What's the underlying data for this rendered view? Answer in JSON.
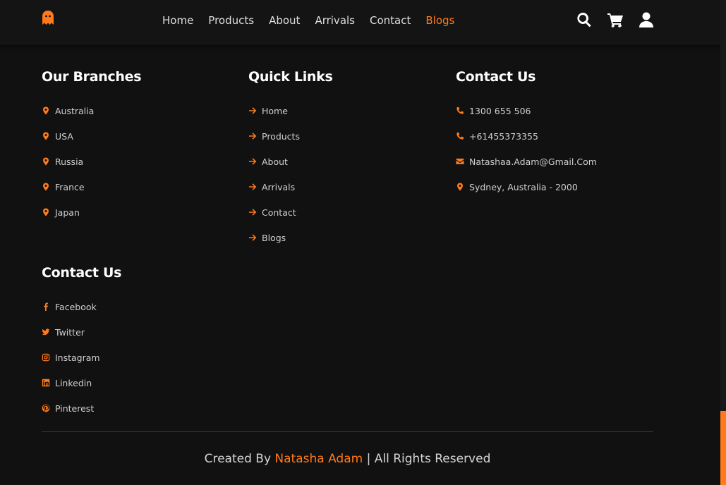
{
  "colors": {
    "accent": "#ff7a1a",
    "background": "#111111",
    "text": "#d6d6d6"
  },
  "nav": {
    "logo_icon": "ghost-logo-icon",
    "links": [
      {
        "label": "Home"
      },
      {
        "label": "Products"
      },
      {
        "label": "About"
      },
      {
        "label": "Arrivals"
      },
      {
        "label": "Contact"
      },
      {
        "label": "Blogs",
        "active": true
      }
    ],
    "icons": [
      "search-icon",
      "shopping-cart-icon",
      "user-icon"
    ]
  },
  "branches": {
    "title": "Our Branches",
    "items": [
      {
        "label": "Australia",
        "icon": "map-marker-icon"
      },
      {
        "label": "USA",
        "icon": "map-marker-icon"
      },
      {
        "label": "Russia",
        "icon": "map-marker-icon"
      },
      {
        "label": "France",
        "icon": "map-marker-icon"
      },
      {
        "label": "Japan",
        "icon": "map-marker-icon"
      }
    ]
  },
  "quick_links": {
    "title": "Quick Links",
    "items": [
      {
        "label": "Home",
        "icon": "arrow-right-icon"
      },
      {
        "label": "Products",
        "icon": "arrow-right-icon"
      },
      {
        "label": "About",
        "icon": "arrow-right-icon"
      },
      {
        "label": "Arrivals",
        "icon": "arrow-right-icon"
      },
      {
        "label": "Contact",
        "icon": "arrow-right-icon"
      },
      {
        "label": "Blogs",
        "icon": "arrow-right-icon"
      }
    ]
  },
  "contact": {
    "title": "Contact Us",
    "items": [
      {
        "label": "1300 655 506",
        "icon": "phone-icon"
      },
      {
        "label": "+61455373355",
        "icon": "phone-icon"
      },
      {
        "label": "Natashaa.Adam@Gmail.Com",
        "icon": "envelope-icon"
      },
      {
        "label": "Sydney, Australia - 2000",
        "icon": "map-marker-icon"
      }
    ]
  },
  "social": {
    "title": "Contact Us",
    "items": [
      {
        "label": "Facebook",
        "icon": "facebook-icon"
      },
      {
        "label": "Twitter",
        "icon": "twitter-icon"
      },
      {
        "label": "Instagram",
        "icon": "instagram-icon"
      },
      {
        "label": "Linkedin",
        "icon": "linkedin-icon"
      },
      {
        "label": "Pinterest",
        "icon": "pinterest-icon"
      }
    ]
  },
  "credit": {
    "prefix": "Created By",
    "author": "Natasha Adam",
    "suffix": "| All Rights Reserved"
  }
}
